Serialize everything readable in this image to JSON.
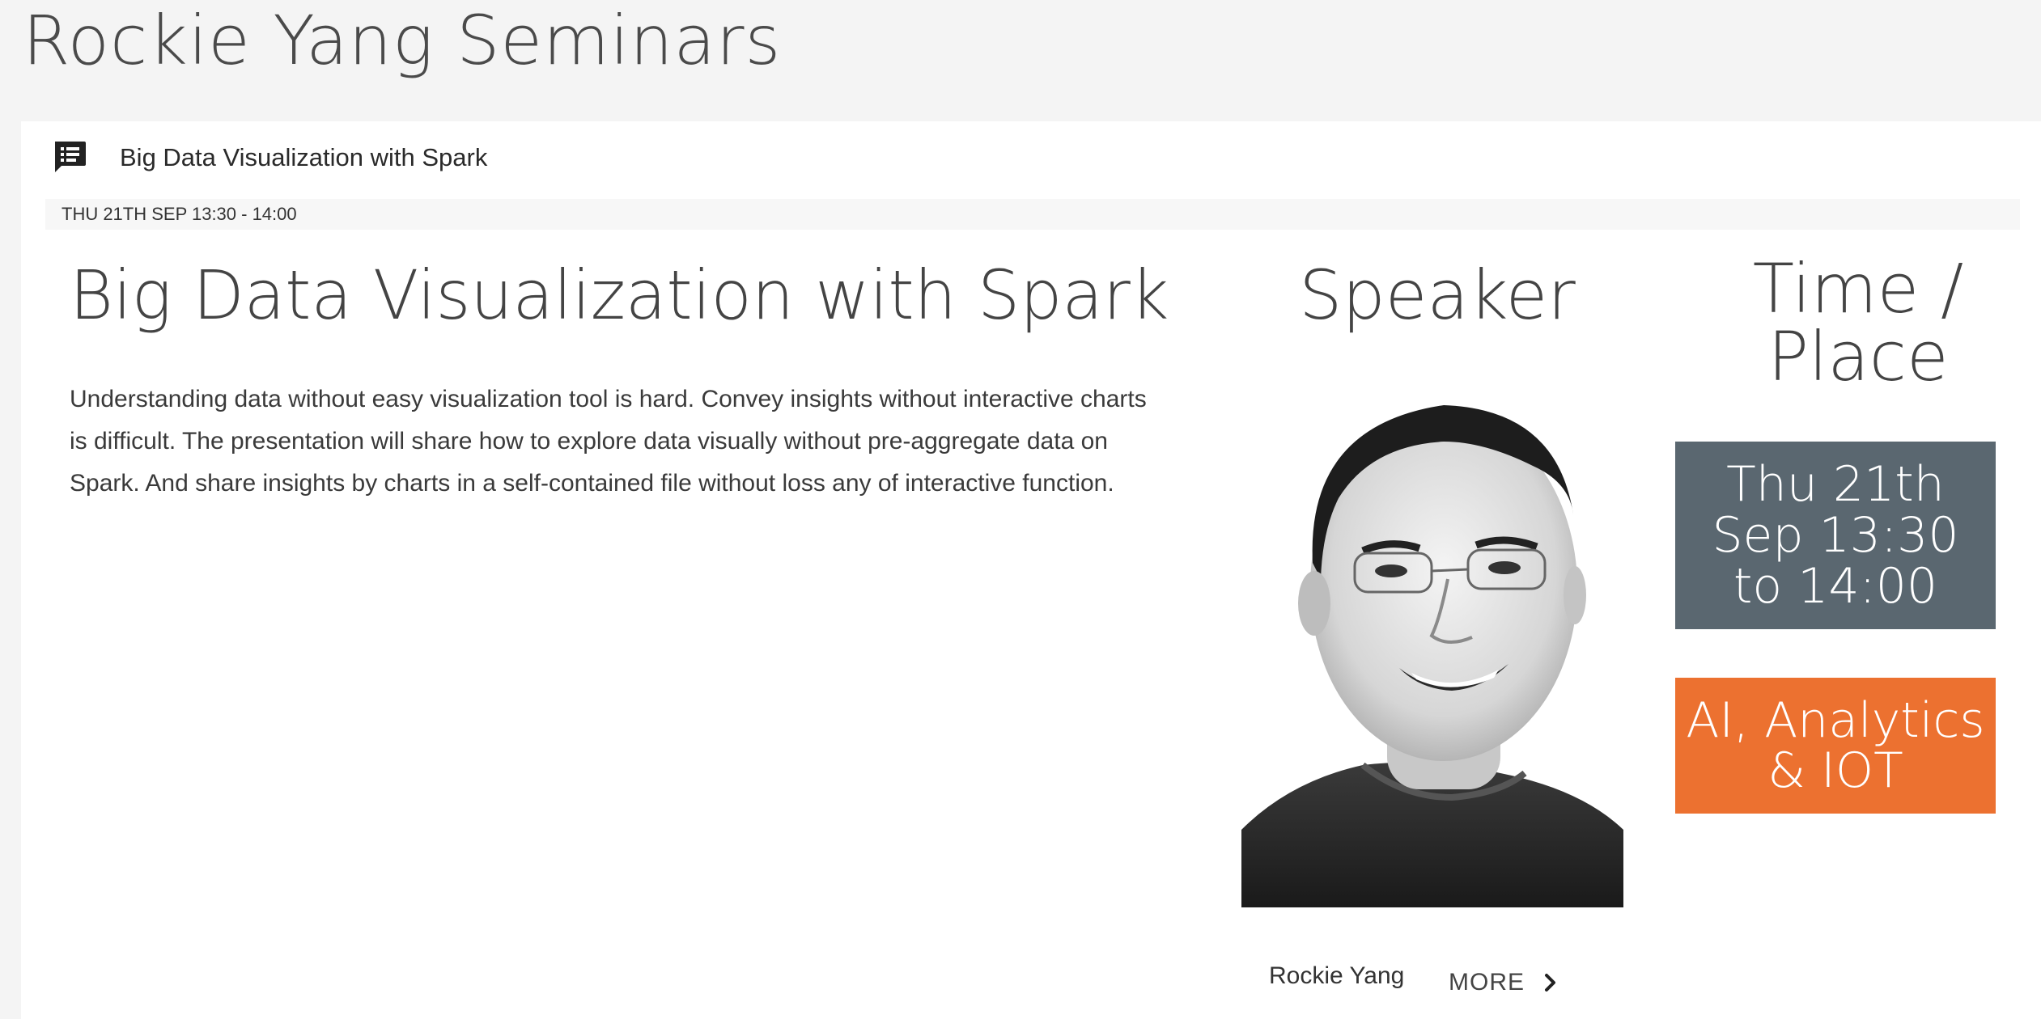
{
  "site": {
    "title": "Rockie Yang Seminars"
  },
  "session": {
    "header_title": "Big Data Visualization with Spark",
    "date_bar": "THU 21TH SEP 13:30 - 14:00",
    "title": "Big Data Visualization with Spark",
    "description": "Understanding data without easy visualization tool is hard. Convey insights without interactive charts is difficult. The presentation will share how to explore data visually without pre-aggregate data on Spark. And share insights by charts in a self-contained file without loss any of interactive function."
  },
  "speaker": {
    "heading": "Speaker",
    "name": "Rockie Yang",
    "more_label": "MORE"
  },
  "time_place": {
    "heading": "Time / Place",
    "time_text": "Thu 21th Sep 13:30 to 14:00",
    "topic_text": "AI, Analytics & IOT"
  },
  "icons": {
    "header_icon": "speaker-notes-icon",
    "more_icon": "chevron-right-icon"
  },
  "colors": {
    "time_box": "#5a6770",
    "topic_box": "#ec7130",
    "page_background": "#f4f4f4"
  }
}
